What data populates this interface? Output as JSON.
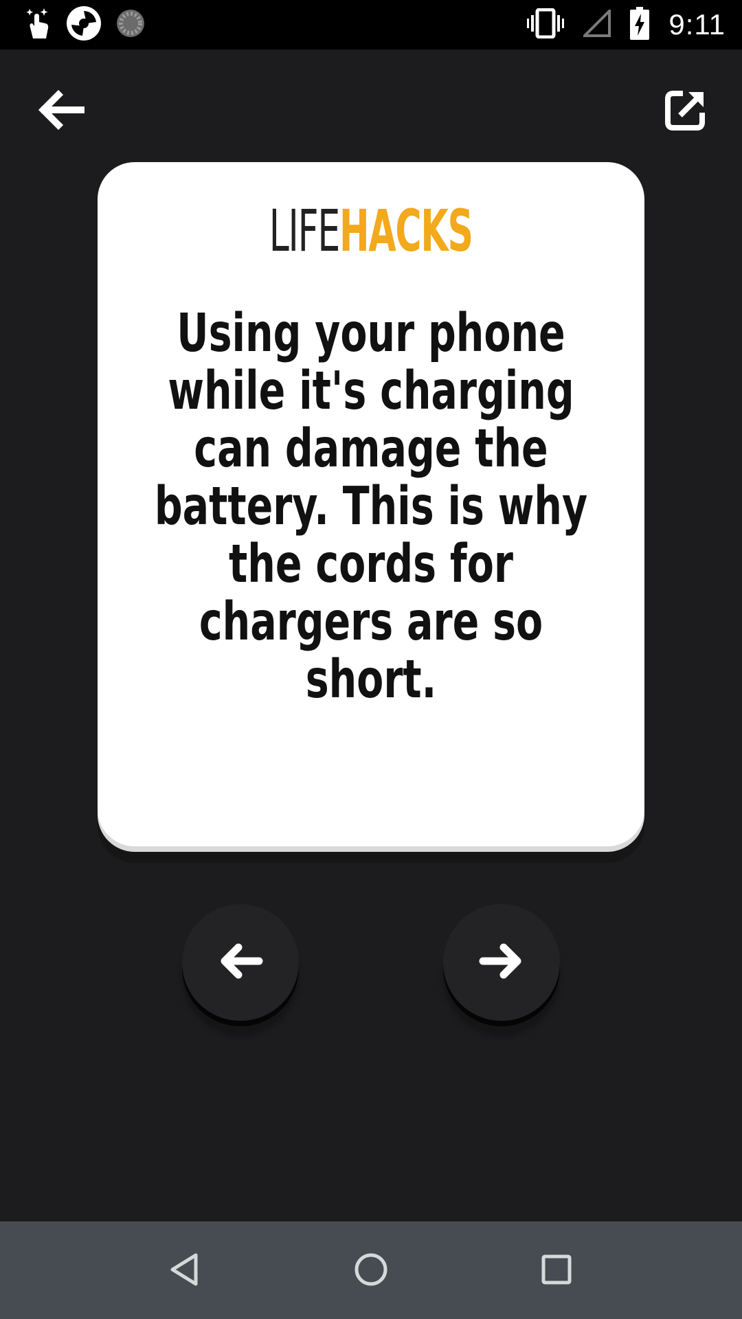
{
  "status_bar": {
    "time": "9:11",
    "left_icons": [
      "touch-sparkle-icon",
      "camera-shutter-icon",
      "loading-spinner-icon"
    ],
    "right_icons": [
      "vibrate-icon",
      "signal-empty-icon",
      "battery-charging-icon"
    ]
  },
  "toolbar": {
    "back_icon": "arrow-left-icon",
    "share_icon": "open-external-icon"
  },
  "card": {
    "logo_part1": "LIFE",
    "logo_part2": "HACKS",
    "fact_text": "Using your phone while it's charging can damage the battery. This is why the cords for chargers are so short."
  },
  "navigation": {
    "prev_icon": "arrow-left-icon",
    "next_icon": "arrow-right-icon"
  },
  "system_nav": {
    "back_icon": "triangle-back-icon",
    "home_icon": "circle-home-icon",
    "recents_icon": "square-recents-icon"
  },
  "colors": {
    "background": "#1c1c1e",
    "card": "#ffffff",
    "accent": "#f2a91c",
    "nav_bar": "#464c52",
    "status_bar": "#000000"
  }
}
